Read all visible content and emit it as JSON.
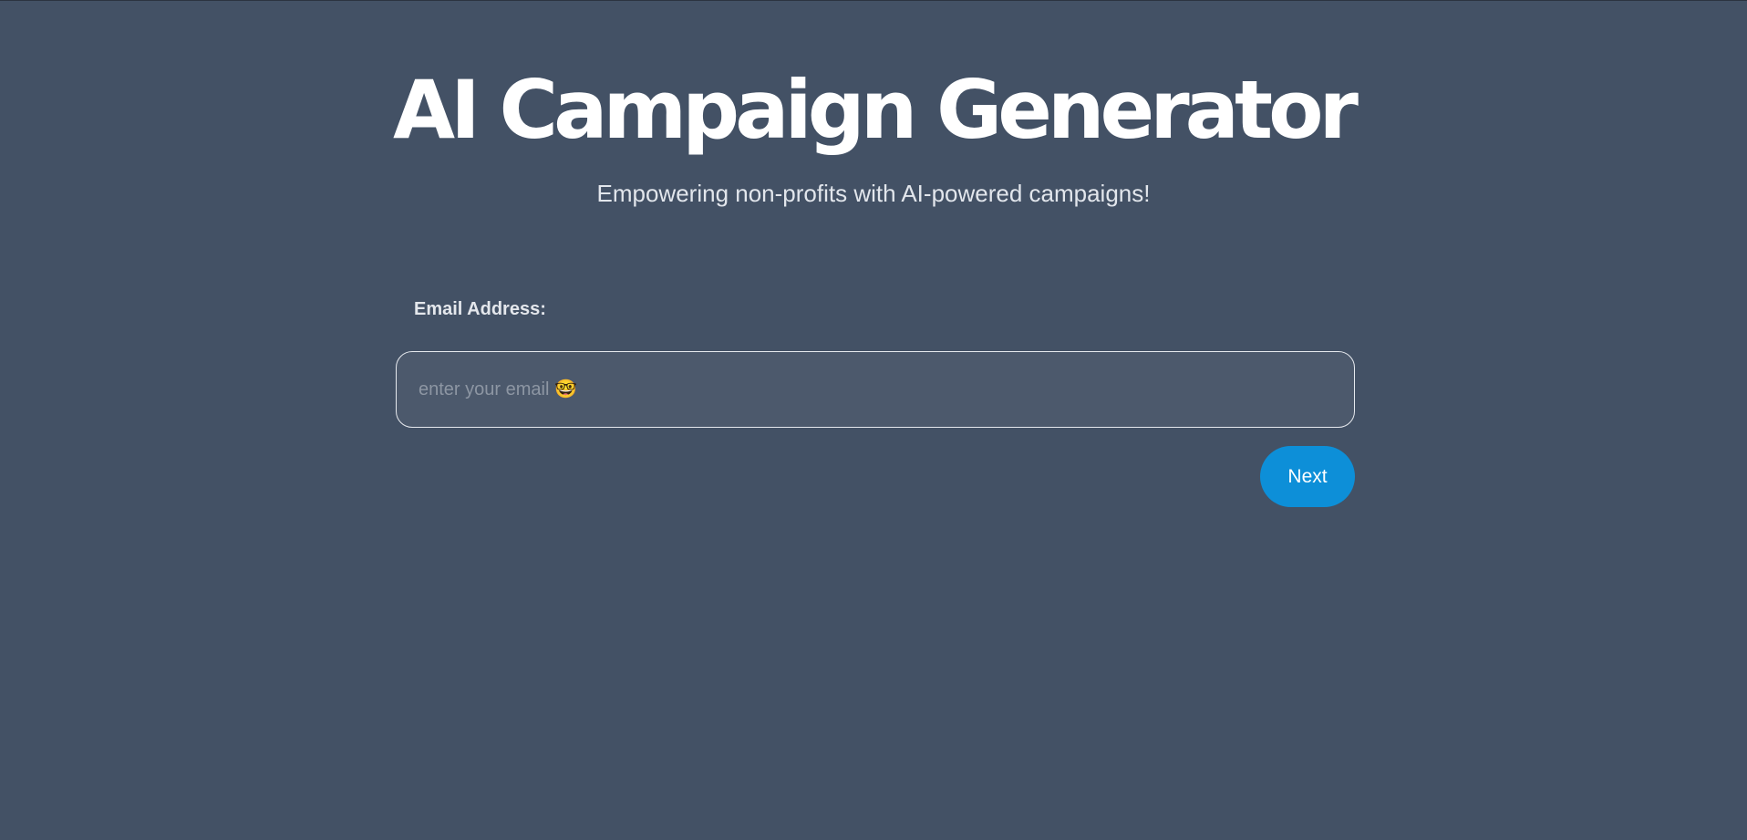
{
  "header": {
    "title": "AI Campaign Generator",
    "subtitle": "Empowering non-profits with AI-powered campaigns!"
  },
  "form": {
    "email_label": "Email Address:",
    "email_value": "",
    "email_placeholder": "enter your email 🤓",
    "next_label": "Next"
  },
  "colors": {
    "background": "#435165",
    "input_background": "#4c596c",
    "accent": "#0d8fd8",
    "text": "#ffffff"
  }
}
